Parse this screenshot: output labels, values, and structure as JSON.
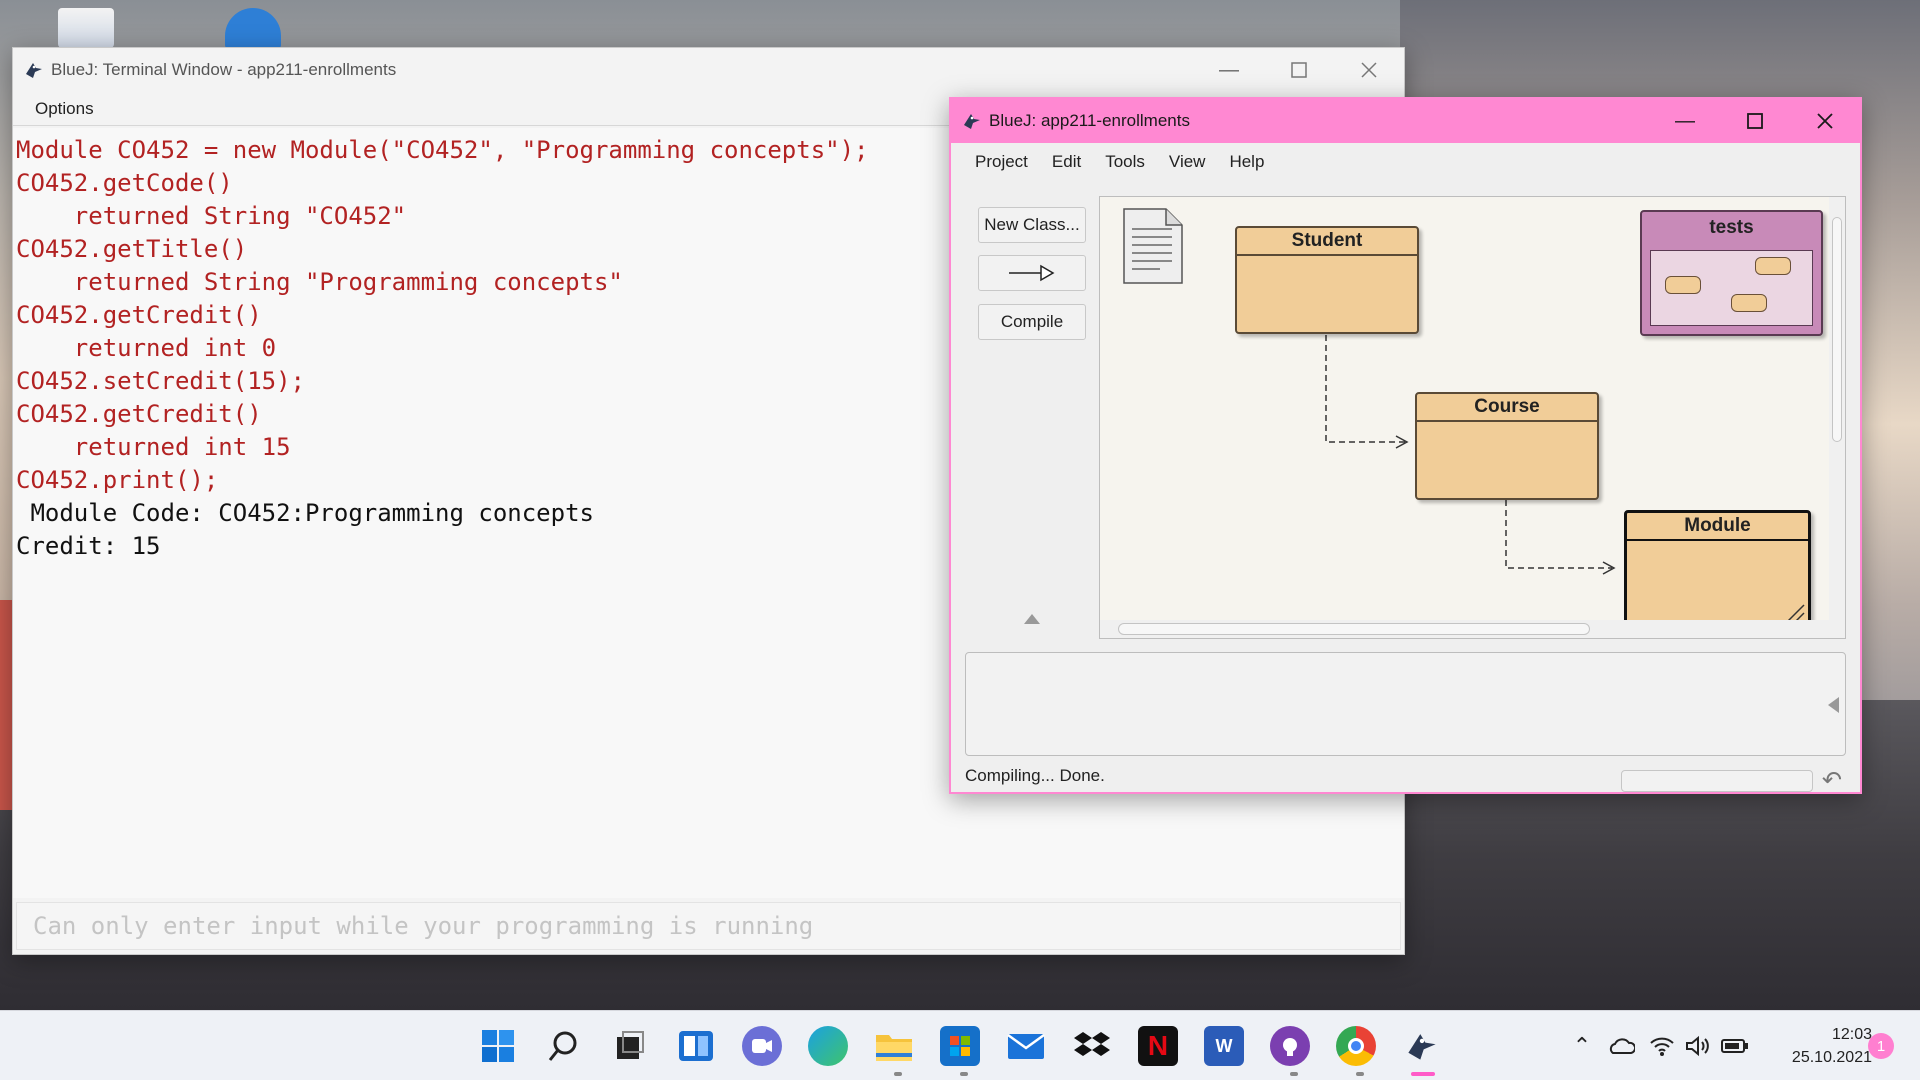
{
  "terminal": {
    "title": "BlueJ: Terminal Window - app211-enrollments",
    "menu": [
      "Options"
    ],
    "lines": [
      {
        "text": "Module CO452 = new Module(\"CO452\", \"Programming concepts\");",
        "color": "#b22222"
      },
      {
        "text": "CO452.getCode()",
        "color": "#b22222"
      },
      {
        "text": "    returned String \"CO452\"",
        "color": "#b22222"
      },
      {
        "text": "CO452.getTitle()",
        "color": "#b22222"
      },
      {
        "text": "    returned String \"Programming concepts\"",
        "color": "#b22222"
      },
      {
        "text": "CO452.getCredit()",
        "color": "#b22222"
      },
      {
        "text": "    returned int 0",
        "color": "#b22222"
      },
      {
        "text": "CO452.setCredit(15);",
        "color": "#b22222"
      },
      {
        "text": "CO452.getCredit()",
        "color": "#b22222"
      },
      {
        "text": "    returned int 15",
        "color": "#b22222"
      },
      {
        "text": "CO452.print();",
        "color": "#b22222"
      },
      {
        "text": " Module Code: CO452:Programming concepts",
        "color": "#111111"
      },
      {
        "text": "Credit: 15",
        "color": "#111111"
      }
    ],
    "input_placeholder": "Can only enter input while your programming is running"
  },
  "bluej": {
    "title": "BlueJ:  app211-enrollments",
    "menu": [
      "Project",
      "Edit",
      "Tools",
      "View",
      "Help"
    ],
    "buttons": {
      "new_class": "New Class...",
      "compile": "Compile"
    },
    "classes": {
      "student": "Student",
      "course": "Course",
      "module": "Module",
      "tests": "tests"
    },
    "status": "Compiling... Done.",
    "accent_color": "#ff88d2"
  },
  "taskbar": {
    "icons": [
      "windows-start-icon",
      "search-icon",
      "task-view-icon",
      "widgets-icon",
      "teams-chat-icon",
      "edge-icon",
      "file-explorer-icon",
      "microsoft-store-icon",
      "mail-icon",
      "dropbox-icon",
      "netflix-icon",
      "word-icon",
      "github-desktop-icon",
      "chrome-icon",
      "bluej-icon"
    ],
    "netflix_label": "N",
    "word_label": "W",
    "time": "12:03",
    "date": "25.10.2021",
    "notification_count": "1"
  }
}
